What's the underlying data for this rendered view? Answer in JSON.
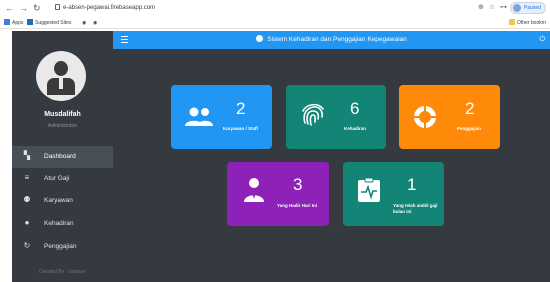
{
  "browser": {
    "url": "e-absen-pegawai.firebaseapp.com",
    "profile_label": "Paused",
    "bookmarks": [
      {
        "label": "Apps"
      },
      {
        "label": "Suggested Sites"
      }
    ],
    "other_bookmarks": "Other bookm"
  },
  "app": {
    "title": "Sistem Kehadiran dan Penggajian Kepegawaian",
    "accent": "#2196f3"
  },
  "sidebar": {
    "user_name": "Musdalifah",
    "user_role": "Administrator",
    "items": [
      {
        "label": "Dashboard",
        "icon": "dashboard-icon"
      },
      {
        "label": "Atur Gaji",
        "icon": "database-icon"
      },
      {
        "label": "Karyawan",
        "icon": "users-icon"
      },
      {
        "label": "Kehadiran",
        "icon": "fingerprint-icon"
      },
      {
        "label": "Penggajian",
        "icon": "refresh-icon"
      }
    ],
    "footer": "Created By : sarlaver"
  },
  "cards": [
    {
      "value": "2",
      "label": "Karyawan / Staff",
      "color": "#2196f3",
      "icon": "users-icon"
    },
    {
      "value": "6",
      "label": "Kehadiran",
      "color": "#138577",
      "icon": "fingerprint-icon"
    },
    {
      "value": "2",
      "label": "Penggajian",
      "color": "#ff8a0a",
      "icon": "pie-chart-icon"
    },
    {
      "value": "3",
      "label": "Yang Hadir Hari Ini",
      "color": "#8e22b8",
      "icon": "person-tie-icon"
    },
    {
      "value": "1",
      "label": "Yang telah ambil gaji bulan ini",
      "color": "#138577",
      "icon": "clipboard-pulse-icon"
    }
  ]
}
